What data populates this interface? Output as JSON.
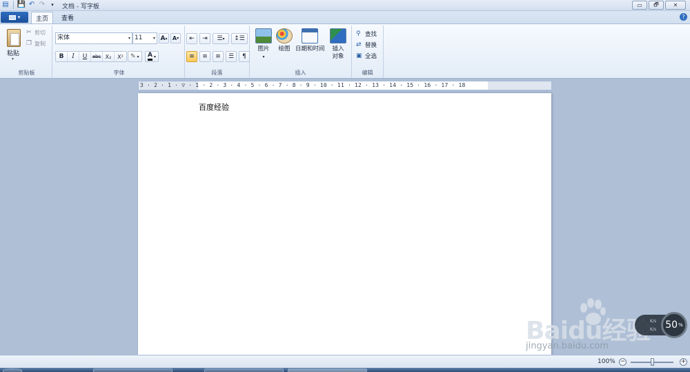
{
  "window": {
    "title": "文档 - 写字板",
    "buttons": {
      "minimize": "▭",
      "restore": "🗗",
      "close": "✕"
    }
  },
  "tabs": {
    "home": "主页",
    "view": "查看"
  },
  "help_icon": "?",
  "ribbon": {
    "clipboard": {
      "label": "剪贴板",
      "paste": "粘贴",
      "cut": "剪切",
      "copy": "复制"
    },
    "font": {
      "label": "字体",
      "font_name": "宋体",
      "font_size": "11",
      "grow": "A",
      "shrink": "A",
      "bold": "B",
      "italic": "I",
      "underline": "U",
      "strike": "abc",
      "subscript": "X₂",
      "superscript": "X²",
      "font_color_letter": "A"
    },
    "paragraph": {
      "label": "段落"
    },
    "insert": {
      "label": "插入",
      "picture": "图片",
      "paint": "绘图",
      "datetime": "日期和时间",
      "object_line1": "插入",
      "object_line2": "对象"
    },
    "editing": {
      "label": "编辑",
      "find": "查找",
      "replace": "替换",
      "select_all": "全选"
    }
  },
  "ruler": {
    "text": "3 · 2 · 1 · ▽ · 1 · 2 · 3 · 4 · 5 · 6 · 7 · 8 · 9 · 10 · 11 · 12 · 13 · 14 · 15 · 16 · 17 · 18"
  },
  "document": {
    "content": "百度经验"
  },
  "status": {
    "zoom": "100%",
    "zoom_level_fraction": 0.5
  },
  "net_widget": {
    "percent": "50",
    "unit": "%",
    "up": "K/s",
    "down": "K/s"
  },
  "watermark": {
    "logo_a": "Bai",
    "logo_b": "du",
    "logo_c": "经验",
    "url": "jingyan.baidu.com"
  },
  "colors": {
    "accent": "#2f6dc0",
    "ribbon_bg": "#e3ecf7",
    "workspace": "#aebfd6"
  }
}
